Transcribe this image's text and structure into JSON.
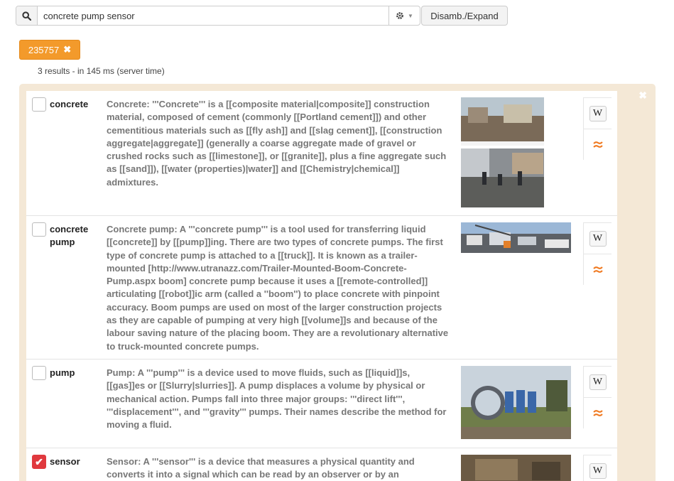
{
  "search": {
    "query": "concrete pump sensor",
    "button_label": "Disamb./Expand"
  },
  "tag": {
    "label": "235757"
  },
  "results_summary": "3 results - in 145 ms (server time)",
  "results": [
    {
      "term": "concrete",
      "checked": false,
      "description": "Concrete: '''Concrete''' is a [[composite material|composite]] construction material, composed of cement (commonly [[Portland cement]]) and other cementitious materials such as [[fly ash]] and [[slag cement]], [[construction aggregate|aggregate]] (generally a coarse aggregate made of gravel or crushed rocks such as [[limestone]], or [[granite]], plus a fine aggregate such as [[sand]]), [[water (properties)|water]] and [[Chemistry|chemical]] admixtures."
    },
    {
      "term": "concrete pump",
      "checked": false,
      "description": "Concrete pump: A '''concrete pump''' is a tool used for transferring liquid [[concrete]] by [[pump]]ing. There are two types of concrete pumps. The first type of concrete pump is attached to a [[truck]]. It is known as a trailer-mounted [http://www.utranazz.com/Trailer-Mounted-Boom-Concrete-Pump.aspx boom] concrete pump because it uses a [[remote-controlled]] articulating [[robot]]ic arm (called a ''boom'') to place concrete with pinpoint accuracy. Boom pumps are used on most of the larger construction projects as they are capable of pumping at very high [[volume]]s and because of the labour saving nature of the placing boom. They are a revolutionary alternative to truck-mounted concrete pumps."
    },
    {
      "term": "pump",
      "checked": false,
      "description": "Pump: A '''pump''' is a device used to move fluids, such as [[liquid]]s, [[gas]]es or [[Slurry|slurries]]. A pump displaces a volume by physical or mechanical action. Pumps fall into three major groups: '''direct lift''', '''displacement''', and '''gravity''' pumps. Their names describe the method for moving a fluid."
    },
    {
      "term": "sensor",
      "checked": true,
      "description": "Sensor: A '''sensor''' is a device that measures a physical quantity and converts it into a signal which can be read by an observer or by an"
    }
  ],
  "icons": {
    "search": "search-icon",
    "settings": "gear-icon",
    "remove_tag": "close-icon",
    "wiki": "wikipedia-icon",
    "source": "freebase-icon"
  },
  "colors": {
    "accent": "#f39a2b",
    "panel": "#f4e8d6",
    "checked": "#e0393e"
  },
  "wiki_glyph": "W"
}
